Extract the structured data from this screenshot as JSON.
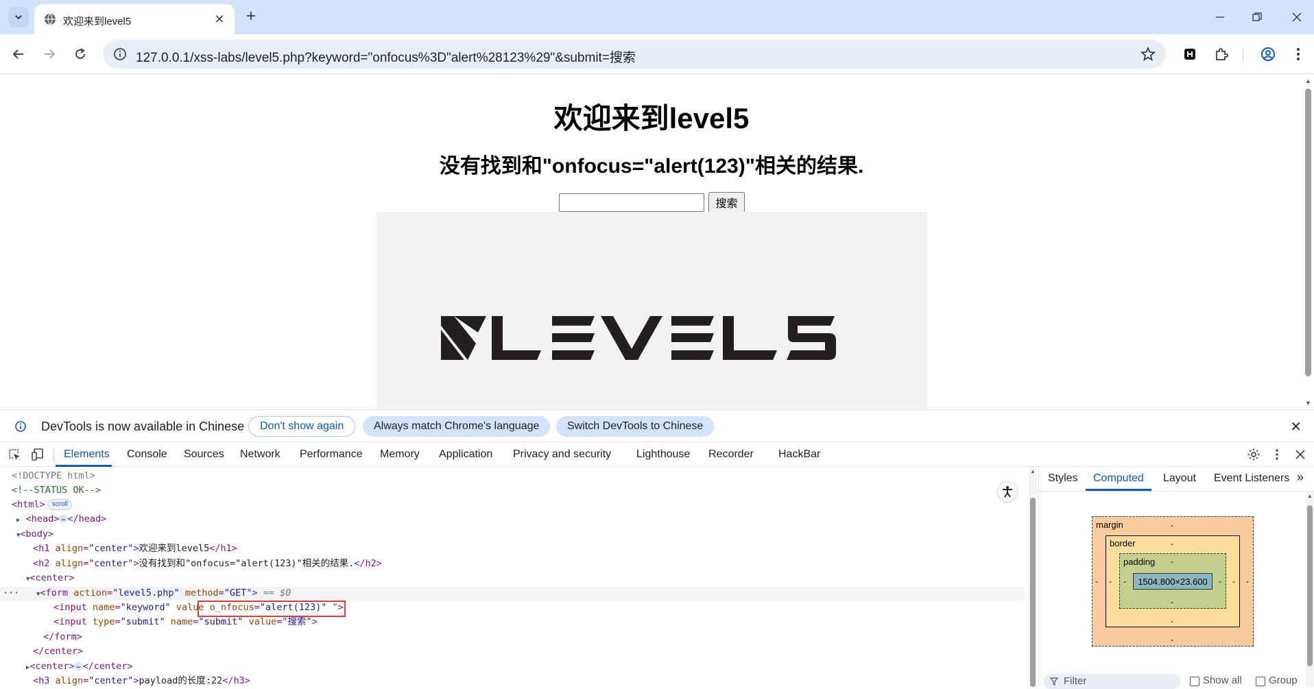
{
  "browser": {
    "tab_title": "欢迎来到level5",
    "url": "127.0.0.1/xss-labs/level5.php?keyword=\"onfocus%3D\"alert%28123%29\"&submit=搜索"
  },
  "page": {
    "h1": "欢迎来到level5",
    "h2": "没有找到和\"onfocus=\"alert(123)\"相关的结果.",
    "input_value": "",
    "submit_label": "搜索",
    "banner_text": "LEVEL5"
  },
  "infobar": {
    "message": "DevTools is now available in Chinese",
    "dont_show": "Don't show again",
    "match_language": "Always match Chrome's language",
    "switch_chinese": "Switch DevTools to Chinese"
  },
  "devtools": {
    "tabs": [
      "Elements",
      "Console",
      "Sources",
      "Network",
      "Performance",
      "Memory",
      "Application",
      "Privacy and security",
      "Lighthouse",
      "Recorder",
      "HackBar"
    ],
    "active_tab": "Elements",
    "side_tabs": [
      "Styles",
      "Computed",
      "Layout",
      "Event Listeners"
    ],
    "active_side_tab": "Computed",
    "dom": {
      "doctype": "<!DOCTYPE html>",
      "comment": "<!--STATUS OK-->",
      "html_tag": "<html>",
      "scroll_badge": "scroll",
      "head_open": "<head>",
      "head_close": "</head>",
      "body_open": "<body>",
      "h1_text": "欢迎来到level5",
      "h2_text": "没有找到和\"onfocus=\"alert(123)\"相关的结果.",
      "center_open": "<center>",
      "form_action": "level5.php",
      "form_method": "GET",
      "selected_marker": "== $0",
      "input1_name": "keyword",
      "input1_attr": "o_nfocus",
      "input1_attr_value": "alert(123)",
      "input2_type": "submit",
      "input2_name": "submit",
      "input2_value": "搜索",
      "form_close": "</form>",
      "center_close": "</center>",
      "h3_text": "payload的长度:22"
    },
    "box_model": {
      "margin_label": "margin",
      "border_label": "border",
      "padding_label": "padding",
      "content_size": "1504.800×23.600",
      "dash": "-"
    },
    "filter": {
      "placeholder": "Filter",
      "show_all": "Show all",
      "group": "Group"
    }
  }
}
